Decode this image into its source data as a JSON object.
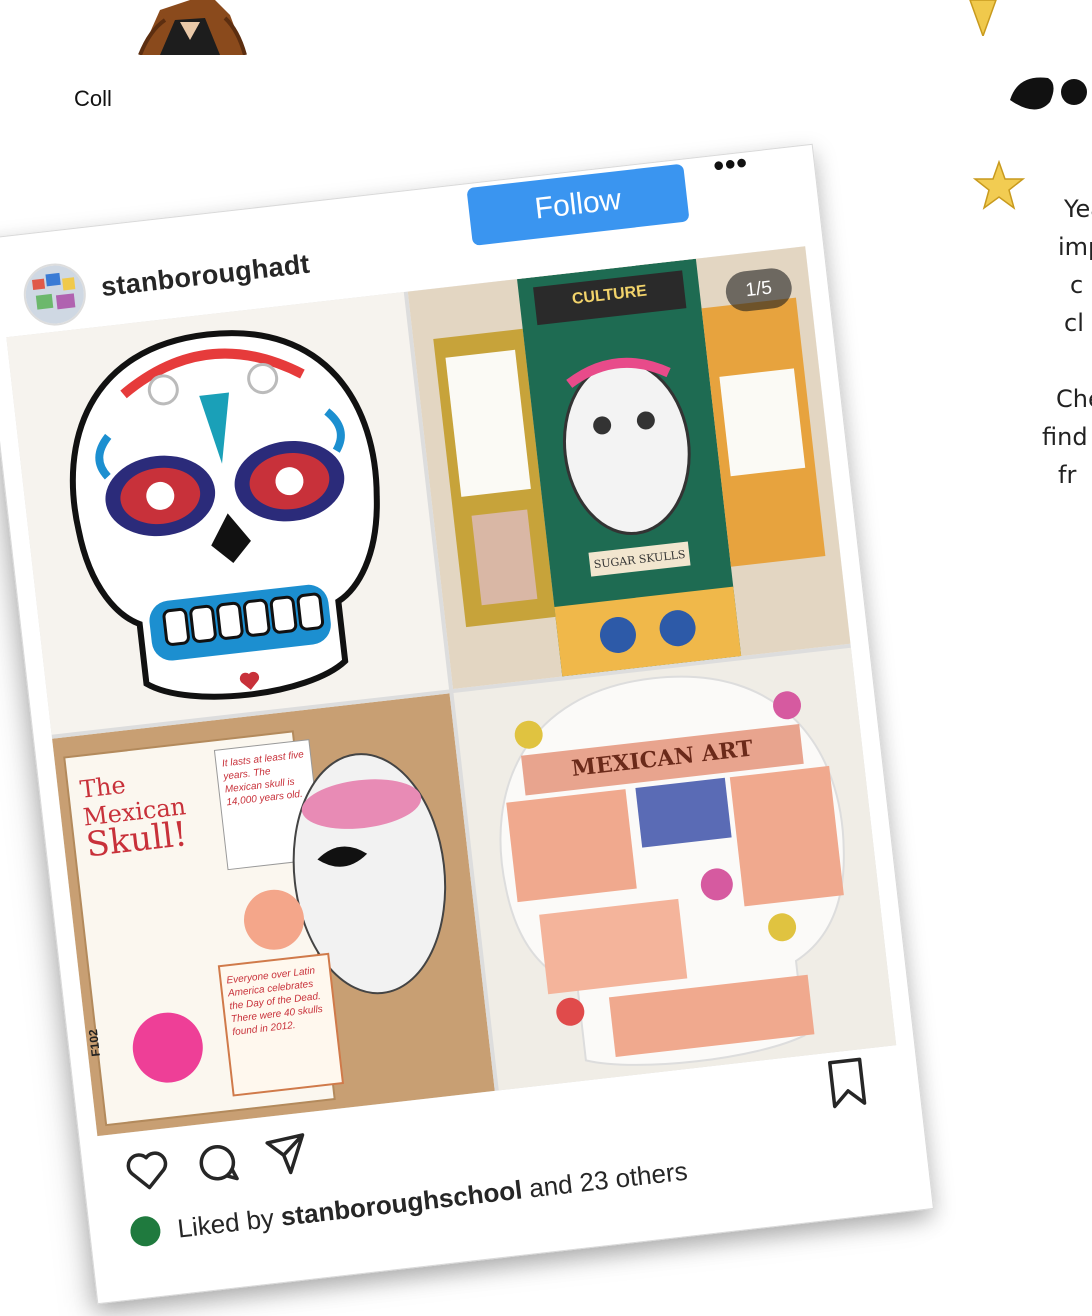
{
  "page": {
    "partial_label": "Coll",
    "side_text_lines": [
      "Yea",
      "imp",
      "c",
      "cl",
      "",
      "Che",
      "find",
      "fr"
    ]
  },
  "post": {
    "username": "stanboroughadt",
    "follow_label": "Follow",
    "more_label": "•••",
    "image_counter": "1/5",
    "tiles": {
      "top_right_banner": "CULTURE",
      "top_right_caption": "SUGAR SKULLS",
      "bottom_left_title_1": "The Mexican",
      "bottom_left_title_2": "Skull!",
      "bottom_left_note_1": "It lasts at least five years. The Mexican skull is 14,000 years old.",
      "bottom_left_note_2": "Everyone over Latin America celebrates the Day of the Dead. There were 40 skulls found in 2012.",
      "bottom_left_side": "F102",
      "bottom_right_title": "MEXICAN ART"
    },
    "liked_prefix": "Liked by",
    "liked_user": "stanboroughschool",
    "liked_suffix": "and 23 others"
  },
  "colors": {
    "follow_button": "#3a95f0",
    "card_background": "#ffffff"
  },
  "icons": [
    "heart-icon",
    "comment-icon",
    "share-icon",
    "bookmark-icon"
  ]
}
